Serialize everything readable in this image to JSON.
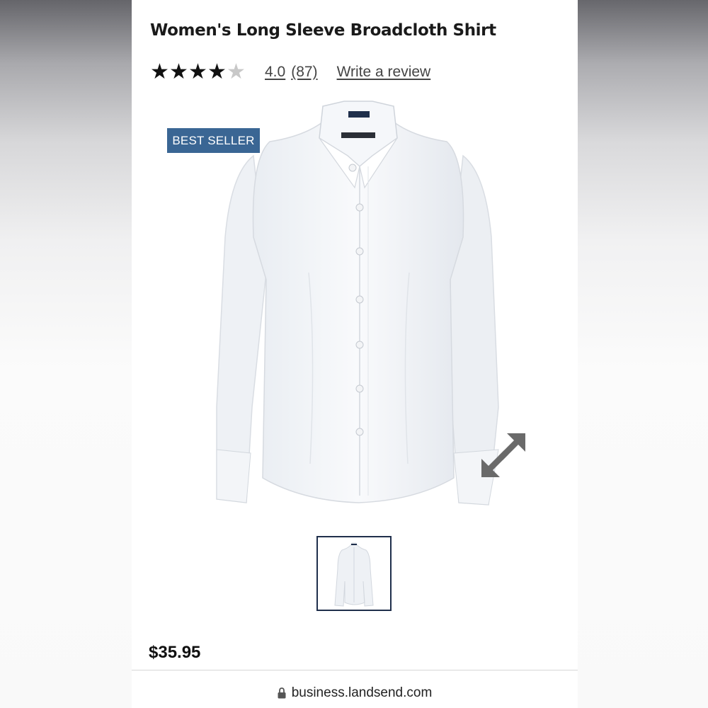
{
  "product": {
    "title": "Women's Long Sleeve Broadcloth Shirt",
    "rating": 4.0,
    "rating_label": "4.0",
    "reviews_label": "(87)",
    "write_review": "Write a review",
    "badge": "BEST SELLER",
    "price": "$35.95"
  },
  "browser": {
    "url": "business.landsend.com"
  },
  "icons": {
    "expand": "expand-icon",
    "lock": "lock-icon",
    "star": "star-icon"
  },
  "colors": {
    "badge": "#3a6694",
    "thumb_border": "#1f2f4b"
  }
}
